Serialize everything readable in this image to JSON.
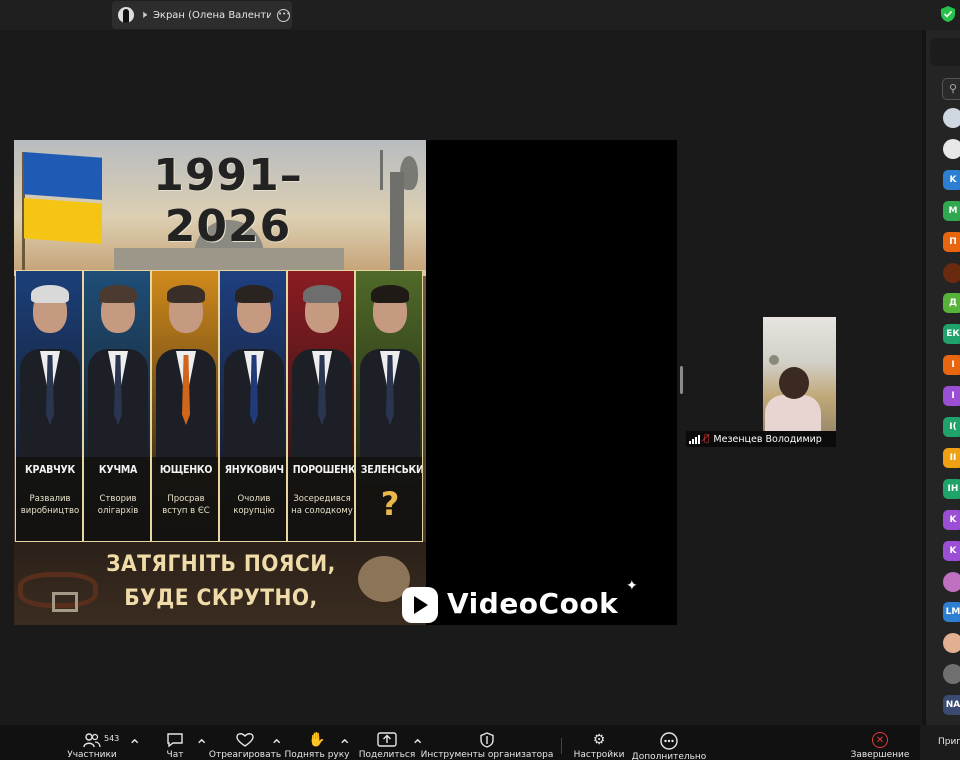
{
  "top_bar": {
    "share_title": "Экран (Олена Валентинівна",
    "speaker_icon": "speaker-icon",
    "more_icon": "more-options-icon",
    "security_icon": "shield-check-icon",
    "security_color": "#27c24c"
  },
  "poster": {
    "years": "1991–2026",
    "presidents": [
      {
        "name": "КРАВЧУК",
        "desc": "Развалив\nвиробництво",
        "bg": "#1b3f7a",
        "hair": "#d9d9d9"
      },
      {
        "name": "КУЧМА",
        "desc": "Створив\nолігархів",
        "bg": "#1f4e78",
        "hair": "#4a3a30"
      },
      {
        "name": "ЮЩЕНКО",
        "desc": "Просрав\nвступ в ЄС",
        "bg": "#d08a1c",
        "hair": "#3a2e28"
      },
      {
        "name": "ЯНУКОВИЧ",
        "desc": "Очолив\nкорупцію",
        "bg": "#1e3f80",
        "hair": "#2a2420"
      },
      {
        "name": "ПОРОШЕНКО",
        "desc": "Зосередився\nна солодкому",
        "bg": "#8a1c22",
        "hair": "#6e6e6e"
      },
      {
        "name": "ЗЕЛЕНСЬКИЙ",
        "desc": "",
        "question": "?",
        "bg": "#4f6a28",
        "hair": "#1f1a16"
      }
    ],
    "slogan_line1": "ЗАТЯГНІТЬ ПОЯСИ,",
    "slogan_line2": "БУДЕ СКРУТНО,",
    "watermark": "VideoCook"
  },
  "participant_tile": {
    "name": "Мезенцев Володимир",
    "mic_muted_icon": "mic-muted-icon",
    "signal_icon": "signal-icon"
  },
  "participants_strip": {
    "search_icon": "search-icon",
    "avatars": [
      {
        "label": "",
        "color": "#cfd8e0",
        "image": true
      },
      {
        "label": "",
        "color": "#e8e8e8",
        "image": true
      },
      {
        "label": "K",
        "color": "#2d7fd1"
      },
      {
        "label": "M",
        "color": "#2fa84f"
      },
      {
        "label": "П",
        "color": "#e8660f"
      },
      {
        "label": "",
        "color": "#6a2a10",
        "image": true
      },
      {
        "label": "Д",
        "color": "#56b33a"
      },
      {
        "label": "ЕК",
        "color": "#1fa36a"
      },
      {
        "label": "I",
        "color": "#e8660f"
      },
      {
        "label": "I",
        "color": "#9b4fd4"
      },
      {
        "label": "I(",
        "color": "#1fa36a"
      },
      {
        "label": "II",
        "color": "#f0a013"
      },
      {
        "label": "IH",
        "color": "#1fa36a"
      },
      {
        "label": "K",
        "color": "#9b4fd4"
      },
      {
        "label": "K",
        "color": "#9b4fd4"
      },
      {
        "label": "",
        "color": "#c070c0",
        "image": true
      },
      {
        "label": "LM",
        "color": "#2d7fd1"
      },
      {
        "label": "",
        "color": "#e0b090",
        "image": true
      },
      {
        "label": "",
        "color": "#707070",
        "image": true
      },
      {
        "label": "NA",
        "color": "#3a4a70"
      }
    ]
  },
  "toolbar": {
    "participants_label": "Участники",
    "participants_count": "543",
    "chat_label": "Чат",
    "react_label": "Отреагировать",
    "raise_hand_label": "Поднять руку",
    "share_label": "Поделиться",
    "host_tools_label": "Инструменты организатора",
    "settings_label": "Настройки",
    "more_label": "Дополнительно",
    "end_label": "Завершение",
    "join_label": "Пригл"
  }
}
